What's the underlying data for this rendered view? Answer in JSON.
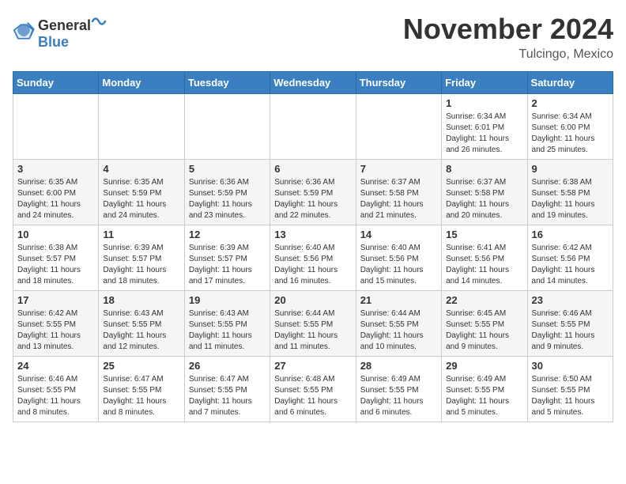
{
  "logo": {
    "general": "General",
    "blue": "Blue"
  },
  "header": {
    "month": "November 2024",
    "location": "Tulcingo, Mexico"
  },
  "weekdays": [
    "Sunday",
    "Monday",
    "Tuesday",
    "Wednesday",
    "Thursday",
    "Friday",
    "Saturday"
  ],
  "weeks": [
    [
      {
        "day": "",
        "info": ""
      },
      {
        "day": "",
        "info": ""
      },
      {
        "day": "",
        "info": ""
      },
      {
        "day": "",
        "info": ""
      },
      {
        "day": "",
        "info": ""
      },
      {
        "day": "1",
        "info": "Sunrise: 6:34 AM\nSunset: 6:01 PM\nDaylight: 11 hours and 26 minutes."
      },
      {
        "day": "2",
        "info": "Sunrise: 6:34 AM\nSunset: 6:00 PM\nDaylight: 11 hours and 25 minutes."
      }
    ],
    [
      {
        "day": "3",
        "info": "Sunrise: 6:35 AM\nSunset: 6:00 PM\nDaylight: 11 hours and 24 minutes."
      },
      {
        "day": "4",
        "info": "Sunrise: 6:35 AM\nSunset: 5:59 PM\nDaylight: 11 hours and 24 minutes."
      },
      {
        "day": "5",
        "info": "Sunrise: 6:36 AM\nSunset: 5:59 PM\nDaylight: 11 hours and 23 minutes."
      },
      {
        "day": "6",
        "info": "Sunrise: 6:36 AM\nSunset: 5:59 PM\nDaylight: 11 hours and 22 minutes."
      },
      {
        "day": "7",
        "info": "Sunrise: 6:37 AM\nSunset: 5:58 PM\nDaylight: 11 hours and 21 minutes."
      },
      {
        "day": "8",
        "info": "Sunrise: 6:37 AM\nSunset: 5:58 PM\nDaylight: 11 hours and 20 minutes."
      },
      {
        "day": "9",
        "info": "Sunrise: 6:38 AM\nSunset: 5:58 PM\nDaylight: 11 hours and 19 minutes."
      }
    ],
    [
      {
        "day": "10",
        "info": "Sunrise: 6:38 AM\nSunset: 5:57 PM\nDaylight: 11 hours and 18 minutes."
      },
      {
        "day": "11",
        "info": "Sunrise: 6:39 AM\nSunset: 5:57 PM\nDaylight: 11 hours and 18 minutes."
      },
      {
        "day": "12",
        "info": "Sunrise: 6:39 AM\nSunset: 5:57 PM\nDaylight: 11 hours and 17 minutes."
      },
      {
        "day": "13",
        "info": "Sunrise: 6:40 AM\nSunset: 5:56 PM\nDaylight: 11 hours and 16 minutes."
      },
      {
        "day": "14",
        "info": "Sunrise: 6:40 AM\nSunset: 5:56 PM\nDaylight: 11 hours and 15 minutes."
      },
      {
        "day": "15",
        "info": "Sunrise: 6:41 AM\nSunset: 5:56 PM\nDaylight: 11 hours and 14 minutes."
      },
      {
        "day": "16",
        "info": "Sunrise: 6:42 AM\nSunset: 5:56 PM\nDaylight: 11 hours and 14 minutes."
      }
    ],
    [
      {
        "day": "17",
        "info": "Sunrise: 6:42 AM\nSunset: 5:55 PM\nDaylight: 11 hours and 13 minutes."
      },
      {
        "day": "18",
        "info": "Sunrise: 6:43 AM\nSunset: 5:55 PM\nDaylight: 11 hours and 12 minutes."
      },
      {
        "day": "19",
        "info": "Sunrise: 6:43 AM\nSunset: 5:55 PM\nDaylight: 11 hours and 11 minutes."
      },
      {
        "day": "20",
        "info": "Sunrise: 6:44 AM\nSunset: 5:55 PM\nDaylight: 11 hours and 11 minutes."
      },
      {
        "day": "21",
        "info": "Sunrise: 6:44 AM\nSunset: 5:55 PM\nDaylight: 11 hours and 10 minutes."
      },
      {
        "day": "22",
        "info": "Sunrise: 6:45 AM\nSunset: 5:55 PM\nDaylight: 11 hours and 9 minutes."
      },
      {
        "day": "23",
        "info": "Sunrise: 6:46 AM\nSunset: 5:55 PM\nDaylight: 11 hours and 9 minutes."
      }
    ],
    [
      {
        "day": "24",
        "info": "Sunrise: 6:46 AM\nSunset: 5:55 PM\nDaylight: 11 hours and 8 minutes."
      },
      {
        "day": "25",
        "info": "Sunrise: 6:47 AM\nSunset: 5:55 PM\nDaylight: 11 hours and 8 minutes."
      },
      {
        "day": "26",
        "info": "Sunrise: 6:47 AM\nSunset: 5:55 PM\nDaylight: 11 hours and 7 minutes."
      },
      {
        "day": "27",
        "info": "Sunrise: 6:48 AM\nSunset: 5:55 PM\nDaylight: 11 hours and 6 minutes."
      },
      {
        "day": "28",
        "info": "Sunrise: 6:49 AM\nSunset: 5:55 PM\nDaylight: 11 hours and 6 minutes."
      },
      {
        "day": "29",
        "info": "Sunrise: 6:49 AM\nSunset: 5:55 PM\nDaylight: 11 hours and 5 minutes."
      },
      {
        "day": "30",
        "info": "Sunrise: 6:50 AM\nSunset: 5:55 PM\nDaylight: 11 hours and 5 minutes."
      }
    ]
  ]
}
